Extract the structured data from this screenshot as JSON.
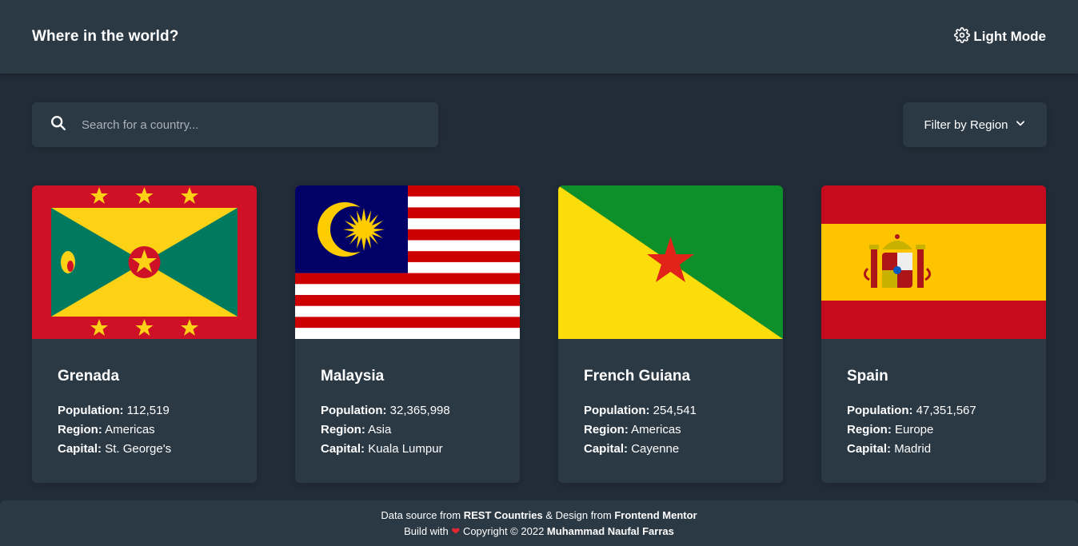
{
  "header": {
    "title": "Where in the world?",
    "mode_label": "Light Mode"
  },
  "search": {
    "placeholder": "Search for a country..."
  },
  "filter": {
    "label": "Filter by Region"
  },
  "labels": {
    "population": "Population:",
    "region": "Region:",
    "capital": "Capital:"
  },
  "countries": [
    {
      "name": "Grenada",
      "population": "112,519",
      "region": "Americas",
      "capital": "St. George's"
    },
    {
      "name": "Malaysia",
      "population": "32,365,998",
      "region": "Asia",
      "capital": "Kuala Lumpur"
    },
    {
      "name": "French Guiana",
      "population": "254,541",
      "region": "Americas",
      "capital": "Cayenne"
    },
    {
      "name": "Spain",
      "population": "47,351,567",
      "region": "Europe",
      "capital": "Madrid"
    }
  ],
  "footer": {
    "line1_prefix": "Data source from",
    "line1_source": "REST Countries",
    "line1_mid": "& Design from",
    "line1_design": "Frontend Mentor",
    "line2_prefix": "Build with",
    "line2_heart": "❤",
    "line2_copyright": "Copyright © 2022",
    "line2_author": "Muhammad Naufal Farras"
  },
  "colors": {
    "background": "#202c37",
    "elements": "#2b3945",
    "text": "#ffffff",
    "heart": "#e8262f"
  }
}
